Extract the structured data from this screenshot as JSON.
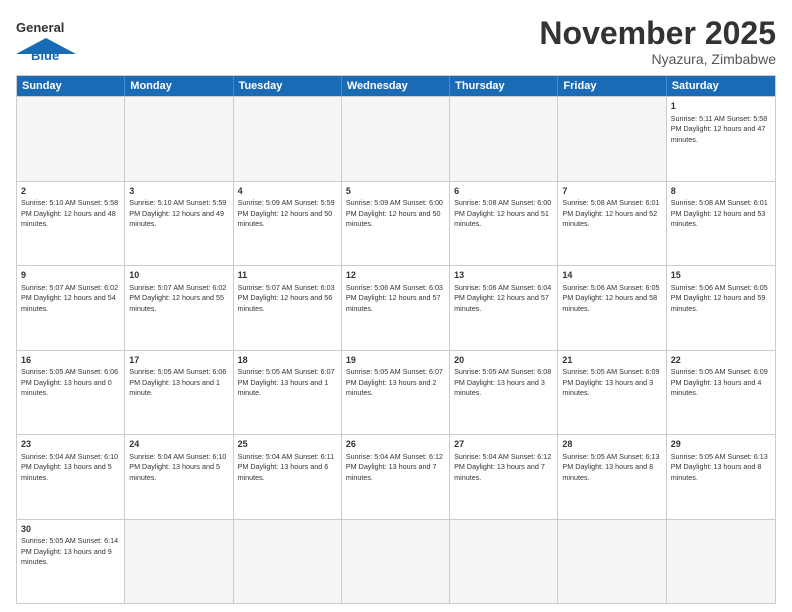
{
  "header": {
    "logo_general": "General",
    "logo_blue": "Blue",
    "month_title": "November 2025",
    "location": "Nyazura, Zimbabwe"
  },
  "days_of_week": [
    "Sunday",
    "Monday",
    "Tuesday",
    "Wednesday",
    "Thursday",
    "Friday",
    "Saturday"
  ],
  "rows": [
    [
      {
        "num": "",
        "info": "",
        "empty": true
      },
      {
        "num": "",
        "info": "",
        "empty": true
      },
      {
        "num": "",
        "info": "",
        "empty": true
      },
      {
        "num": "",
        "info": "",
        "empty": true
      },
      {
        "num": "",
        "info": "",
        "empty": true
      },
      {
        "num": "",
        "info": "",
        "empty": true
      },
      {
        "num": "1",
        "info": "Sunrise: 5:11 AM\nSunset: 5:58 PM\nDaylight: 12 hours\nand 47 minutes.",
        "empty": false
      }
    ],
    [
      {
        "num": "2",
        "info": "Sunrise: 5:10 AM\nSunset: 5:58 PM\nDaylight: 12 hours\nand 48 minutes.",
        "empty": false
      },
      {
        "num": "3",
        "info": "Sunrise: 5:10 AM\nSunset: 5:59 PM\nDaylight: 12 hours\nand 49 minutes.",
        "empty": false
      },
      {
        "num": "4",
        "info": "Sunrise: 5:09 AM\nSunset: 5:59 PM\nDaylight: 12 hours\nand 50 minutes.",
        "empty": false
      },
      {
        "num": "5",
        "info": "Sunrise: 5:09 AM\nSunset: 6:00 PM\nDaylight: 12 hours\nand 50 minutes.",
        "empty": false
      },
      {
        "num": "6",
        "info": "Sunrise: 5:08 AM\nSunset: 6:00 PM\nDaylight: 12 hours\nand 51 minutes.",
        "empty": false
      },
      {
        "num": "7",
        "info": "Sunrise: 5:08 AM\nSunset: 6:01 PM\nDaylight: 12 hours\nand 52 minutes.",
        "empty": false
      },
      {
        "num": "8",
        "info": "Sunrise: 5:08 AM\nSunset: 6:01 PM\nDaylight: 12 hours\nand 53 minutes.",
        "empty": false
      }
    ],
    [
      {
        "num": "9",
        "info": "Sunrise: 5:07 AM\nSunset: 6:02 PM\nDaylight: 12 hours\nand 54 minutes.",
        "empty": false
      },
      {
        "num": "10",
        "info": "Sunrise: 5:07 AM\nSunset: 6:02 PM\nDaylight: 12 hours\nand 55 minutes.",
        "empty": false
      },
      {
        "num": "11",
        "info": "Sunrise: 5:07 AM\nSunset: 6:03 PM\nDaylight: 12 hours\nand 56 minutes.",
        "empty": false
      },
      {
        "num": "12",
        "info": "Sunrise: 5:06 AM\nSunset: 6:03 PM\nDaylight: 12 hours\nand 57 minutes.",
        "empty": false
      },
      {
        "num": "13",
        "info": "Sunrise: 5:06 AM\nSunset: 6:04 PM\nDaylight: 12 hours\nand 57 minutes.",
        "empty": false
      },
      {
        "num": "14",
        "info": "Sunrise: 5:06 AM\nSunset: 6:05 PM\nDaylight: 12 hours\nand 58 minutes.",
        "empty": false
      },
      {
        "num": "15",
        "info": "Sunrise: 5:06 AM\nSunset: 6:05 PM\nDaylight: 12 hours\nand 59 minutes.",
        "empty": false
      }
    ],
    [
      {
        "num": "16",
        "info": "Sunrise: 5:05 AM\nSunset: 6:06 PM\nDaylight: 13 hours\nand 0 minutes.",
        "empty": false
      },
      {
        "num": "17",
        "info": "Sunrise: 5:05 AM\nSunset: 6:06 PM\nDaylight: 13 hours\nand 1 minute.",
        "empty": false
      },
      {
        "num": "18",
        "info": "Sunrise: 5:05 AM\nSunset: 6:07 PM\nDaylight: 13 hours\nand 1 minute.",
        "empty": false
      },
      {
        "num": "19",
        "info": "Sunrise: 5:05 AM\nSunset: 6:07 PM\nDaylight: 13 hours\nand 2 minutes.",
        "empty": false
      },
      {
        "num": "20",
        "info": "Sunrise: 5:05 AM\nSunset: 6:08 PM\nDaylight: 13 hours\nand 3 minutes.",
        "empty": false
      },
      {
        "num": "21",
        "info": "Sunrise: 5:05 AM\nSunset: 6:09 PM\nDaylight: 13 hours\nand 3 minutes.",
        "empty": false
      },
      {
        "num": "22",
        "info": "Sunrise: 5:05 AM\nSunset: 6:09 PM\nDaylight: 13 hours\nand 4 minutes.",
        "empty": false
      }
    ],
    [
      {
        "num": "23",
        "info": "Sunrise: 5:04 AM\nSunset: 6:10 PM\nDaylight: 13 hours\nand 5 minutes.",
        "empty": false
      },
      {
        "num": "24",
        "info": "Sunrise: 5:04 AM\nSunset: 6:10 PM\nDaylight: 13 hours\nand 5 minutes.",
        "empty": false
      },
      {
        "num": "25",
        "info": "Sunrise: 5:04 AM\nSunset: 6:11 PM\nDaylight: 13 hours\nand 6 minutes.",
        "empty": false
      },
      {
        "num": "26",
        "info": "Sunrise: 5:04 AM\nSunset: 6:12 PM\nDaylight: 13 hours\nand 7 minutes.",
        "empty": false
      },
      {
        "num": "27",
        "info": "Sunrise: 5:04 AM\nSunset: 6:12 PM\nDaylight: 13 hours\nand 7 minutes.",
        "empty": false
      },
      {
        "num": "28",
        "info": "Sunrise: 5:05 AM\nSunset: 6:13 PM\nDaylight: 13 hours\nand 8 minutes.",
        "empty": false
      },
      {
        "num": "29",
        "info": "Sunrise: 5:05 AM\nSunset: 6:13 PM\nDaylight: 13 hours\nand 8 minutes.",
        "empty": false
      }
    ],
    [
      {
        "num": "30",
        "info": "Sunrise: 5:05 AM\nSunset: 6:14 PM\nDaylight: 13 hours\nand 9 minutes.",
        "empty": false
      },
      {
        "num": "",
        "info": "",
        "empty": true
      },
      {
        "num": "",
        "info": "",
        "empty": true
      },
      {
        "num": "",
        "info": "",
        "empty": true
      },
      {
        "num": "",
        "info": "",
        "empty": true
      },
      {
        "num": "",
        "info": "",
        "empty": true
      },
      {
        "num": "",
        "info": "",
        "empty": true
      }
    ]
  ]
}
